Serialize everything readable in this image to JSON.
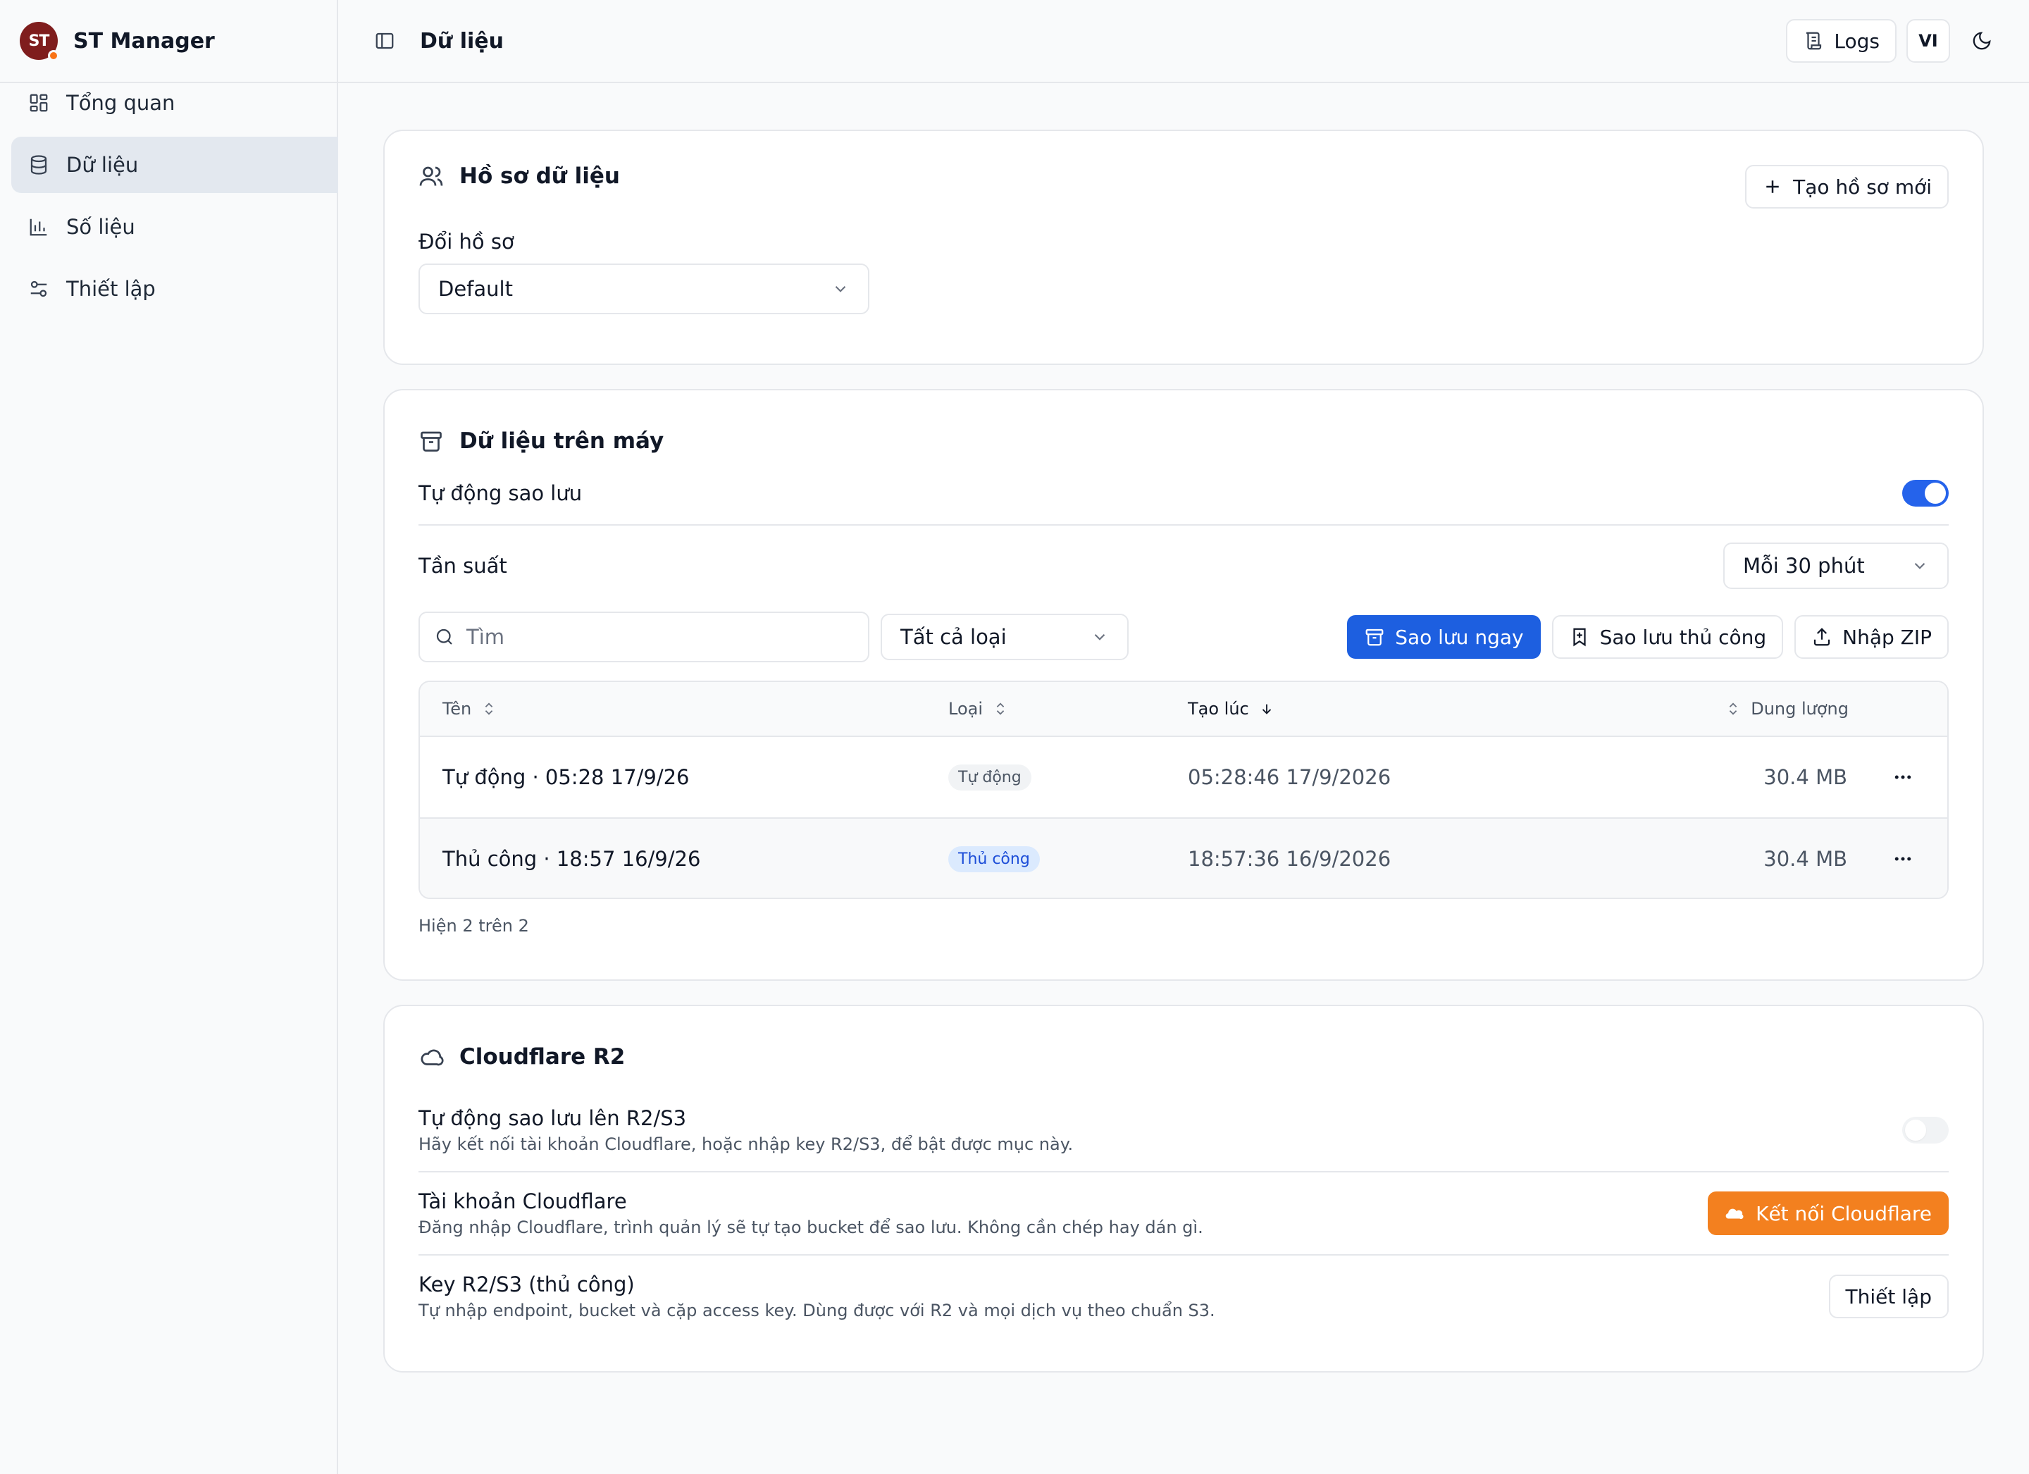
{
  "brand": {
    "logo_text": "ST",
    "name": "ST Manager"
  },
  "sidebar": {
    "items": [
      {
        "label": "Tổng quan",
        "icon": "dashboard-icon"
      },
      {
        "label": "Dữ liệu",
        "icon": "database-icon",
        "active": true
      },
      {
        "label": "Số liệu",
        "icon": "bar-chart-icon"
      },
      {
        "label": "Thiết lập",
        "icon": "sliders-icon"
      }
    ]
  },
  "header": {
    "title": "Dữ liệu",
    "logs_label": "Logs",
    "lang_label": "VI"
  },
  "profile_card": {
    "title": "Hồ sơ dữ liệu",
    "new_button": "Tạo hồ sơ mới",
    "switch_label": "Đổi hồ sơ",
    "selected_profile": "Default"
  },
  "local_card": {
    "title": "Dữ liệu trên máy",
    "auto_backup_label": "Tự động sao lưu",
    "auto_backup_on": true,
    "frequency_label": "Tần suất",
    "frequency_value": "Mỗi 30 phút",
    "search_placeholder": "Tìm",
    "type_filter": "Tất cả loại",
    "backup_now": "Sao lưu ngay",
    "manual_backup": "Sao lưu thủ công",
    "import_zip": "Nhập ZIP",
    "columns": {
      "name": "Tên",
      "type": "Loại",
      "created": "Tạo lúc",
      "size": "Dung lượng"
    },
    "rows": [
      {
        "name": "Tự động · 05:28 17/9/26",
        "type": "Tự động",
        "created": "05:28:46 17/9/2026",
        "size": "30.4 MB"
      },
      {
        "name": "Thủ công · 18:57 16/9/26",
        "type": "Thủ công",
        "created": "18:57:36 16/9/2026",
        "size": "30.4 MB"
      }
    ],
    "footer": "Hiện 2 trên 2"
  },
  "r2_card": {
    "title": "Cloudflare R2",
    "auto_title": "Tự động sao lưu lên R2/S3",
    "auto_desc": "Hãy kết nối tài khoản Cloudflare, hoặc nhập key R2/S3, để bật được mục này.",
    "account_title": "Tài khoản Cloudflare",
    "account_desc": "Đăng nhập Cloudflare, trình quản lý sẽ tự tạo bucket để sao lưu. Không cần chép hay dán gì.",
    "connect_button": "Kết nối Cloudflare",
    "key_title": "Key R2/S3 (thủ công)",
    "key_desc": "Tự nhập endpoint, bucket và cặp access key. Dùng được với R2 và mọi dịch vụ theo chuẩn S3.",
    "setup_button": "Thiết lập"
  },
  "colors": {
    "primary": "#1d5fe0",
    "orange": "#f3801f",
    "logo": "#7f1d1d"
  }
}
